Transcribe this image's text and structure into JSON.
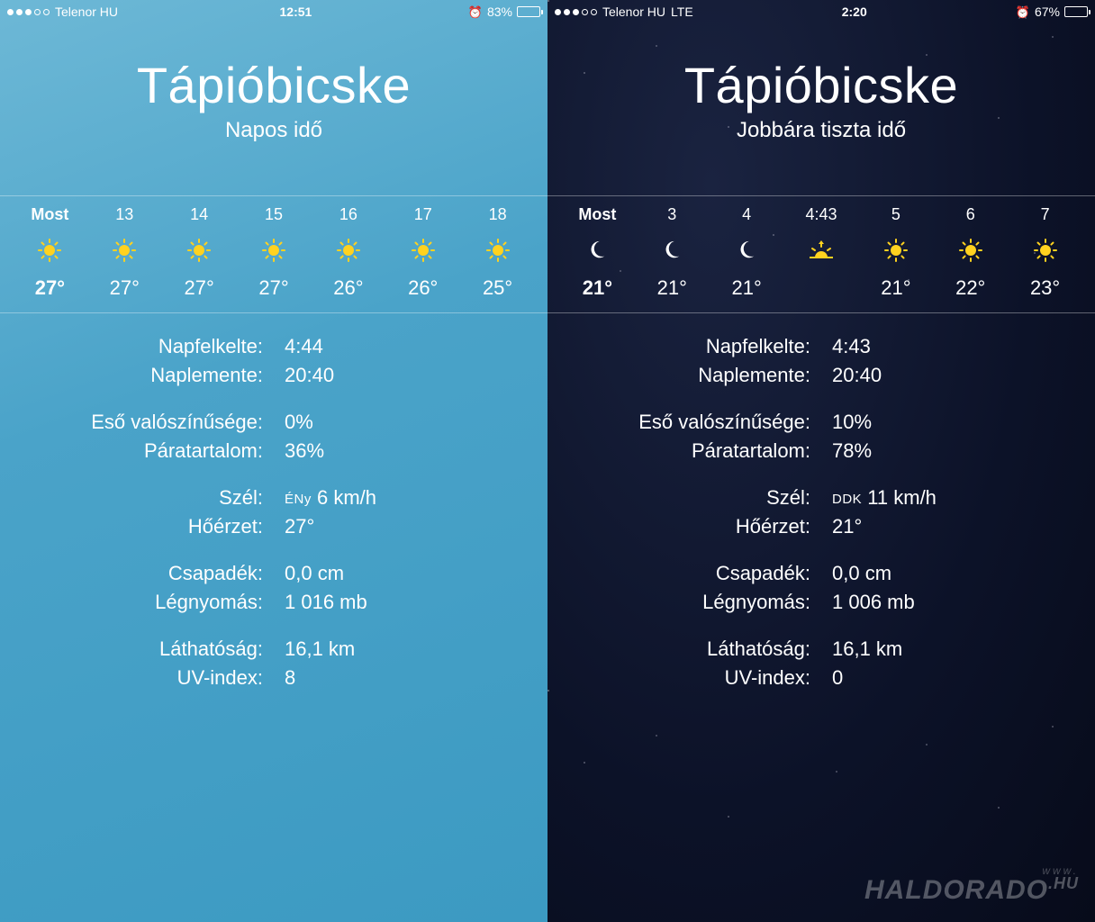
{
  "left": {
    "status": {
      "carrier": "Telenor HU",
      "network": "",
      "time": "12:51",
      "battery_pct": "83%",
      "battery_fill": 83,
      "signal_filled": 3
    },
    "city": "Tápióbicske",
    "condition": "Napos idő",
    "hourly": [
      {
        "label": "Most",
        "icon": "sun",
        "temp": "27°"
      },
      {
        "label": "13",
        "icon": "sun",
        "temp": "27°"
      },
      {
        "label": "14",
        "icon": "sun",
        "temp": "27°"
      },
      {
        "label": "15",
        "icon": "sun",
        "temp": "27°"
      },
      {
        "label": "16",
        "icon": "sun",
        "temp": "26°"
      },
      {
        "label": "17",
        "icon": "sun",
        "temp": "26°"
      },
      {
        "label": "18",
        "icon": "sun",
        "temp": "25°"
      }
    ],
    "details": {
      "sunrise_label": "Napfelkelte:",
      "sunrise_value": "4:44",
      "sunset_label": "Naplemente:",
      "sunset_value": "20:40",
      "rain_label": "Eső valószínűsége:",
      "rain_value": "0%",
      "humidity_label": "Páratartalom:",
      "humidity_value": "36%",
      "wind_label": "Szél:",
      "wind_dir": "ÉNy",
      "wind_value": "6 km/h",
      "feels_label": "Hőérzet:",
      "feels_value": "27°",
      "precip_label": "Csapadék:",
      "precip_value": "0,0 cm",
      "pressure_label": "Légnyomás:",
      "pressure_value": "1 016 mb",
      "visibility_label": "Láthatóság:",
      "visibility_value": "16,1 km",
      "uv_label": "UV-index:",
      "uv_value": "8"
    }
  },
  "right": {
    "status": {
      "carrier": "Telenor HU",
      "network": "LTE",
      "time": "2:20",
      "battery_pct": "67%",
      "battery_fill": 67,
      "signal_filled": 3
    },
    "city": "Tápióbicske",
    "condition": "Jobbára tiszta idő",
    "hourly": [
      {
        "label": "Most",
        "icon": "moon",
        "temp": "21°"
      },
      {
        "label": "3",
        "icon": "moon",
        "temp": "21°"
      },
      {
        "label": "4",
        "icon": "moon",
        "temp": "21°"
      },
      {
        "label": "4:43",
        "icon": "sunrise",
        "temp": ""
      },
      {
        "label": "5",
        "icon": "sun",
        "temp": "21°"
      },
      {
        "label": "6",
        "icon": "sun",
        "temp": "22°"
      },
      {
        "label": "7",
        "icon": "sun",
        "temp": "23°"
      }
    ],
    "details": {
      "sunrise_label": "Napfelkelte:",
      "sunrise_value": "4:43",
      "sunset_label": "Naplemente:",
      "sunset_value": "20:40",
      "rain_label": "Eső valószínűsége:",
      "rain_value": "10%",
      "humidity_label": "Páratartalom:",
      "humidity_value": "78%",
      "wind_label": "Szél:",
      "wind_dir": "DDK",
      "wind_value": "11 km/h",
      "feels_label": "Hőérzet:",
      "feels_value": "21°",
      "precip_label": "Csapadék:",
      "precip_value": "0,0 cm",
      "pressure_label": "Légnyomás:",
      "pressure_value": "1 006 mb",
      "visibility_label": "Láthatóság:",
      "visibility_value": "16,1 km",
      "uv_label": "UV-index:",
      "uv_value": "0"
    }
  },
  "watermark": {
    "small": "www.",
    "main": "HALDORADO",
    "suffix": ".HU"
  }
}
